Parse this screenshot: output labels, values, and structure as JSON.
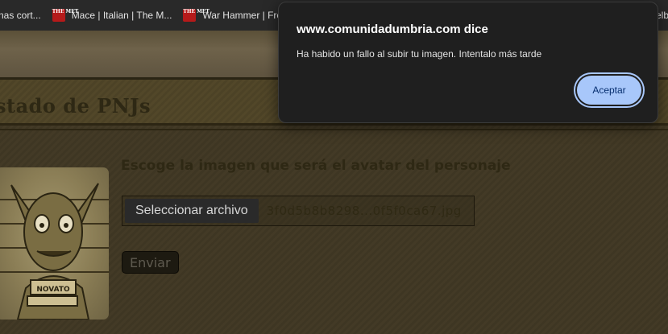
{
  "bookmarks": [
    {
      "label": "nas cort...",
      "icon": ""
    },
    {
      "label": "Mace | Italian | The M...",
      "icon": "THE MET"
    },
    {
      "label": "War Hammer | Fren",
      "icon": "THE MET"
    },
    {
      "label": "elb",
      "icon": ""
    }
  ],
  "page": {
    "title": "stado de PNJs",
    "prompt": "Escoge la imagen que será el avatar del personaje",
    "file_button": "Seleccionar archivo",
    "file_name": "3f0d5b8b8298...0f5f0ca67.jpg",
    "submit": "Enviar",
    "avatar_badge": "NOVATO"
  },
  "dialog": {
    "origin": "www.comunidadumbria.com dice",
    "message": "Ha habido un fallo al subir tu imagen. Intentalo más tarde",
    "ok_button": "Aceptar"
  },
  "colors": {
    "dialog_bg": "#1f1f1f",
    "dialog_button": "#a8c7fa",
    "page_bg": "#433a26"
  }
}
